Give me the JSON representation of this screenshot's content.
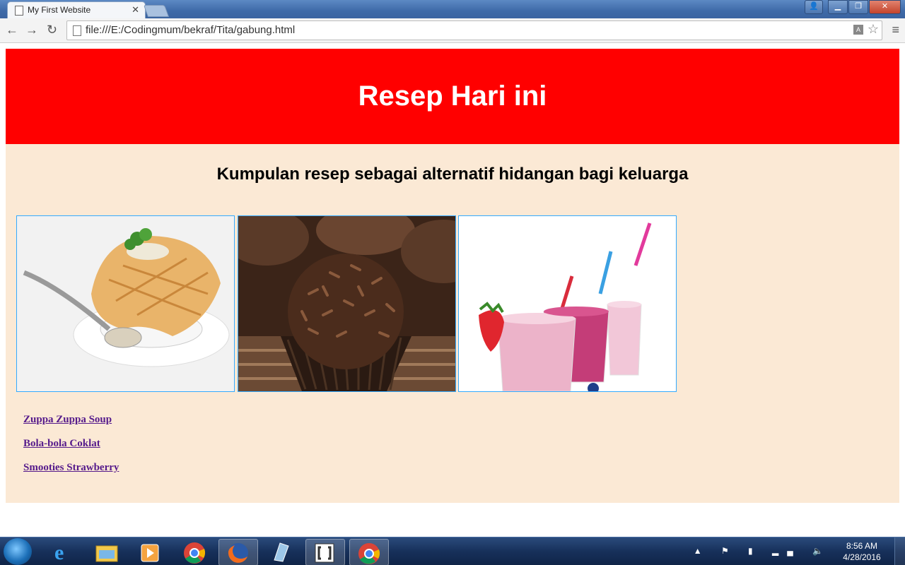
{
  "browser": {
    "tab_title": "My First Website",
    "url": "file:///E:/Codingmum/bekraf/Tita/gabung.html"
  },
  "page": {
    "header_title": "Resep Hari ini",
    "subtitle": "Kumpulan resep sebagai alternatif hidangan bagi keluarga",
    "images": [
      {
        "alt": "zuppa-soup"
      },
      {
        "alt": "chocolate-ball"
      },
      {
        "alt": "strawberry-smoothies"
      }
    ],
    "links": [
      "Zuppa Zuppa Soup",
      "Bola-bola Coklat",
      "Smooties Strawberry"
    ],
    "colors": {
      "header_bg": "#ff0000",
      "content_bg": "#fbe9d5",
      "link": "#551a8b"
    }
  },
  "taskbar": {
    "time": "8:56 AM",
    "date": "4/28/2016",
    "apps": [
      "internet-explorer",
      "file-explorer",
      "media-player",
      "chrome",
      "firefox",
      "notepad",
      "brackets",
      "chrome-active"
    ]
  }
}
